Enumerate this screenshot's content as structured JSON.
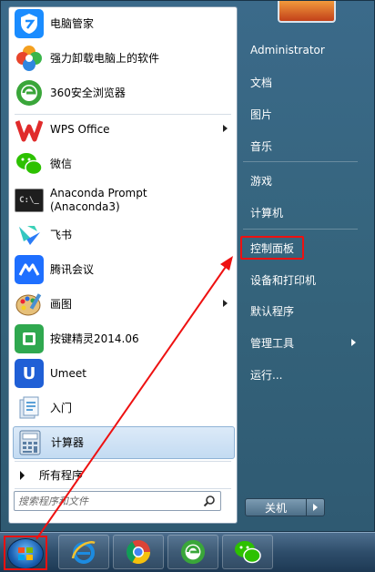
{
  "programs": [
    {
      "name": "tencent-pc-manager",
      "label": "电脑管家",
      "icon": "shield-icon",
      "color": "#1a8cff",
      "submenu": false
    },
    {
      "name": "uninstall-software",
      "label": "强力卸载电脑上的软件",
      "icon": "clover-icon",
      "color": "#f4a020",
      "submenu": false
    },
    {
      "name": "360-browser",
      "label": "360安全浏览器",
      "icon": "360-browser-icon",
      "color": "#3aa63a",
      "submenu": false
    },
    {
      "name": "wps-office",
      "label": "WPS Office",
      "icon": "wps-icon",
      "color": "#e02b2b",
      "submenu": true
    },
    {
      "name": "wechat",
      "label": "微信",
      "icon": "wechat-icon",
      "color": "#2dc100",
      "submenu": false
    },
    {
      "name": "anaconda-prompt",
      "label_line1": "Anaconda Prompt",
      "label_line2": "(Anaconda3)",
      "icon": "terminal-icon",
      "color": "#1e1e1e",
      "submenu": false
    },
    {
      "name": "feishu",
      "label": "飞书",
      "icon": "feishu-icon",
      "color": "#2b7cf7",
      "submenu": false
    },
    {
      "name": "tencent-meeting",
      "label": "腾讯会议",
      "icon": "tencent-meeting-icon",
      "color": "#1e6fff",
      "submenu": false
    },
    {
      "name": "paint",
      "label": "画图",
      "icon": "paint-palette-icon",
      "color": "#d9a24a",
      "submenu": true
    },
    {
      "name": "anjian-jingling",
      "label": "按键精灵2014.06",
      "icon": "anjian-icon",
      "color": "#2fa84f",
      "submenu": false
    },
    {
      "name": "umeet",
      "label": "Umeet",
      "icon": "umeet-icon",
      "color": "#1f5fd6",
      "submenu": false
    },
    {
      "name": "getting-started",
      "label": "入门",
      "icon": "getting-started-icon",
      "color": "#5aa0d8",
      "submenu": false
    },
    {
      "name": "calculator",
      "label": "计算器",
      "icon": "calculator-icon",
      "color": "#6b8fb5",
      "submenu": false
    }
  ],
  "all_programs": "所有程序",
  "search": {
    "placeholder": "搜索程序和文件"
  },
  "right": {
    "user": "Administrator",
    "items": [
      {
        "name": "documents",
        "label": "文档"
      },
      {
        "name": "pictures",
        "label": "图片"
      },
      {
        "name": "music",
        "label": "音乐"
      },
      {
        "name": "games",
        "label": "游戏"
      },
      {
        "name": "computer",
        "label": "计算机"
      },
      {
        "name": "control-panel",
        "label": "控制面板"
      },
      {
        "name": "devices-printers",
        "label": "设备和打印机"
      },
      {
        "name": "default-programs",
        "label": "默认程序"
      },
      {
        "name": "admin-tools",
        "label": "管理工具"
      },
      {
        "name": "run",
        "label": "运行..."
      }
    ]
  },
  "shutdown_label": "关机",
  "taskbar": [
    "start-orb-icon",
    "ie-icon",
    "chrome-icon",
    "360-browser-icon",
    "wechat-icon"
  ],
  "highlight_color": "#e11111"
}
